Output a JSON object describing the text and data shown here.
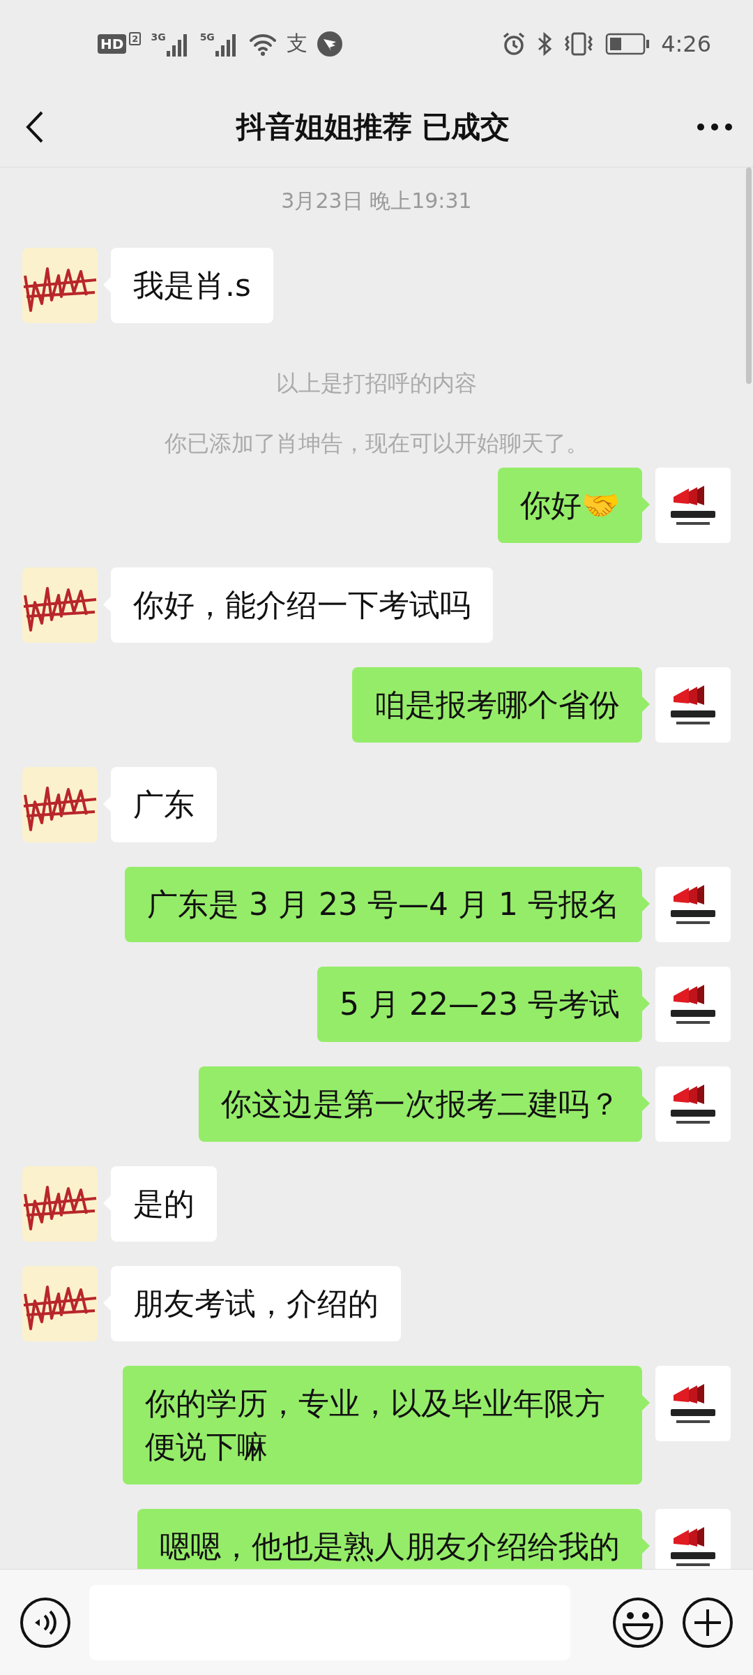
{
  "status_bar": {
    "hd": "HD",
    "sim": "2",
    "net_1": "3G",
    "net_2": "5G",
    "pay_glyph": "支",
    "time": "4:26"
  },
  "header": {
    "title": "抖音姐姐推荐 已成交"
  },
  "messages": [
    {
      "kind": "time",
      "text": "3月23日 晚上19:31"
    },
    {
      "kind": "incoming",
      "text": "我是肖.s"
    },
    {
      "kind": "system",
      "text": "以上是打招呼的内容"
    },
    {
      "kind": "system",
      "text": "你已添加了肖坤告，现在可以开始聊天了。"
    },
    {
      "kind": "outgoing",
      "text": "你好🤝"
    },
    {
      "kind": "incoming",
      "text": "你好，能介绍一下考试吗"
    },
    {
      "kind": "outgoing",
      "text": "咱是报考哪个省份"
    },
    {
      "kind": "incoming",
      "text": "广东"
    },
    {
      "kind": "outgoing",
      "text": "广东是 3 月 23 号—4 月 1 号报名"
    },
    {
      "kind": "outgoing",
      "text": "5 月 22—23 号考试"
    },
    {
      "kind": "outgoing",
      "text": "你这边是第一次报考二建吗？"
    },
    {
      "kind": "incoming",
      "text": "是的"
    },
    {
      "kind": "incoming",
      "text": "朋友考试，介绍的"
    },
    {
      "kind": "outgoing",
      "text": "你的学历，专业，以及毕业年限方便说下嘛"
    },
    {
      "kind": "outgoing",
      "text": "嗯嗯，他也是熟人朋友介绍给我的"
    }
  ]
}
